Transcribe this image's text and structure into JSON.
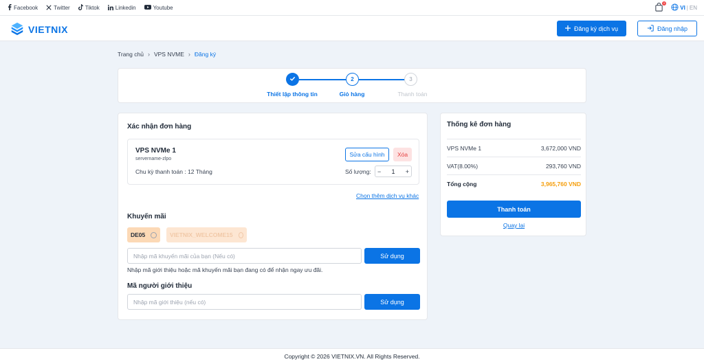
{
  "topbar": {
    "social": [
      {
        "icon": "facebook-icon",
        "label": "Facebook"
      },
      {
        "icon": "x-twitter-icon",
        "label": "Twitter"
      },
      {
        "icon": "tiktok-icon",
        "label": "Tiktok"
      },
      {
        "icon": "linkedin-icon",
        "label": "Linkedin"
      },
      {
        "icon": "youtube-icon",
        "label": "Youtube"
      }
    ],
    "cart_count": "0",
    "lang_vi": "VI",
    "lang_sep": "|",
    "lang_en": "EN"
  },
  "header": {
    "logo_text": "VIETNIX",
    "register_label": "Đăng ký dịch vụ",
    "login_label": "Đăng nhập"
  },
  "breadcrumb": {
    "home": "Trang chủ",
    "product": "VPS NVME",
    "current": "Đăng ký"
  },
  "steps": [
    {
      "number": "",
      "label": "Thiết lập thông tin",
      "state": "done"
    },
    {
      "number": "2",
      "label": "Giỏ hàng",
      "state": "active"
    },
    {
      "number": "3",
      "label": "Thanh toán",
      "state": "pending"
    }
  ],
  "order": {
    "title": "Xác nhận đơn hàng",
    "product_name": "VPS NVMe 1",
    "hostname": "servername-zlpo",
    "cycle": "Chu kỳ thanh toán : 12 Tháng",
    "edit_label": "Sửa cấu hình",
    "delete_label": "Xóa",
    "qty_label": "Số lượng:",
    "qty_minus": "−",
    "qty_value": "1",
    "qty_plus": "+",
    "more_link": "Chọn thêm dịch vụ khác"
  },
  "promo": {
    "title": "Khuyến mãi",
    "codes": [
      {
        "code": "DE05",
        "enabled": true
      },
      {
        "code": "VIETNIX_WELCOME15",
        "enabled": false
      }
    ],
    "input_placeholder": "Nhập mã khuyến mãi của bạn (Nếu có)",
    "use_label": "Sử dụng",
    "hint": "Nhập mã giới thiệu hoặc mã khuyến mãi bạn đang có để nhận ngay ưu đãi."
  },
  "referral": {
    "title": "Mã người giới thiệu",
    "input_placeholder": "Nhập mã giới thiệu (nếu có)",
    "use_label": "Sử dụng"
  },
  "summary": {
    "title": "Thống kê đơn hàng",
    "rows": [
      {
        "label": "VPS NVMe 1",
        "value": "3,672,000 VND"
      },
      {
        "label": "VAT(8.00%)",
        "value": "293,760 VND"
      },
      {
        "label": "Tổng cộng",
        "value": "3,965,760 VND"
      }
    ],
    "pay_label": "Thanh toán",
    "back_label": "Quay lại"
  },
  "footer": {
    "copyright": "Copyright © 2026 VIETNIX.VN. All Rights Reserved."
  },
  "colors": {
    "primary": "#0b74e5",
    "total": "#f59e0b",
    "promo_active_bg": "#fcd9b6",
    "promo_disabled_bg": "#fde6d2",
    "delete_bg": "#fde2e2"
  }
}
